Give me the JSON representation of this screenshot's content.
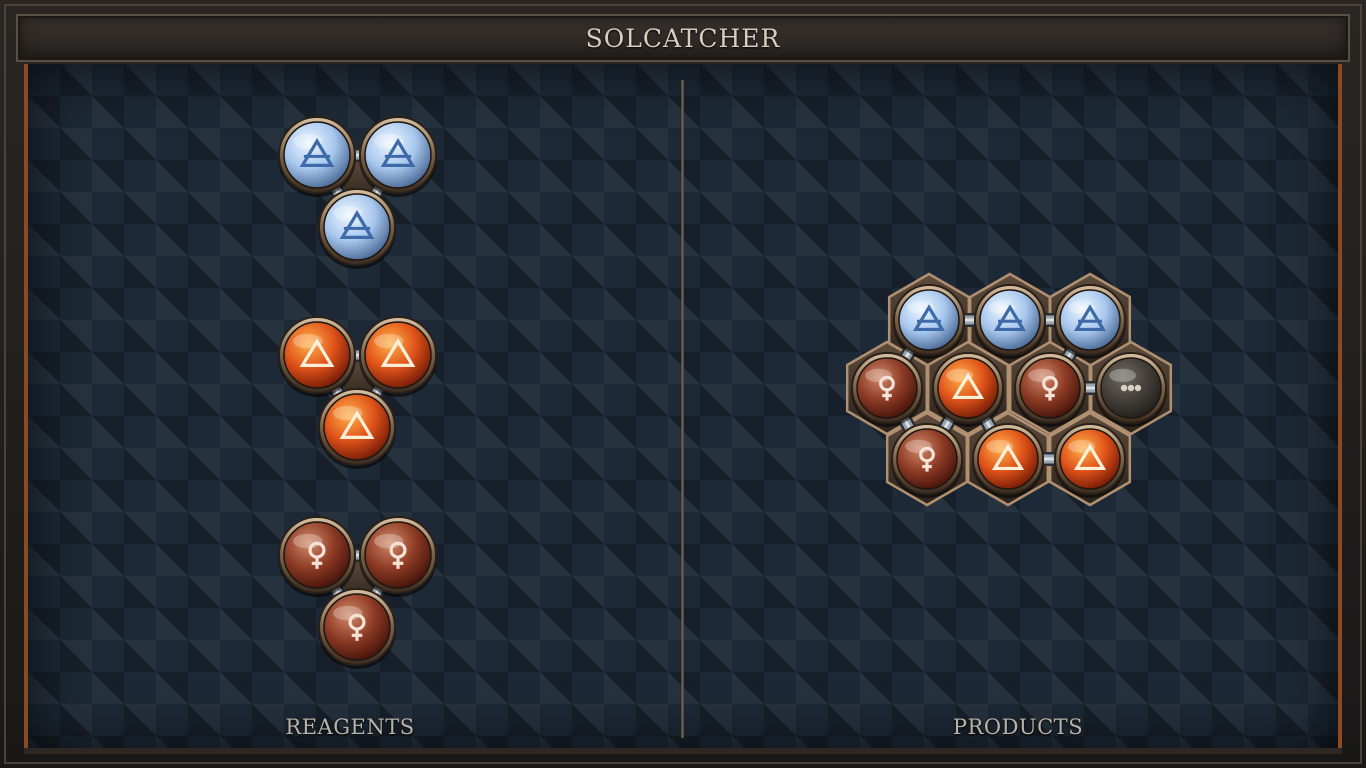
{
  "window": {
    "title": "SOLCATCHER"
  },
  "panels": {
    "reagents_label": "REAGENTS",
    "products_label": "PRODUCTS"
  },
  "element_types": {
    "air": {
      "name": "air",
      "symbol_icon": "air-triangle-icon",
      "colors": [
        "#eef6ff",
        "#a8c8ee",
        "#4f6e9a"
      ],
      "glyph_color": "#3e6aa8"
    },
    "fire": {
      "name": "fire",
      "symbol_icon": "fire-triangle-icon",
      "colors": [
        "#ffb24a",
        "#e0531a",
        "#7a1e08"
      ],
      "glyph_color": "#fff0d8"
    },
    "venus": {
      "name": "venus",
      "symbol_icon": "venus-icon",
      "colors": [
        "#d08a6a",
        "#8e3b25",
        "#4a160c"
      ],
      "glyph_color": "#f6e2d6"
    },
    "empty": {
      "name": "empty",
      "symbol_icon": "ellipsis-icon",
      "colors": [
        "#6e6a62",
        "#444039",
        "#24221e"
      ],
      "glyph_color": "#d6d2c8"
    }
  },
  "reagents": [
    {
      "name": "air-triad",
      "atoms": [
        "air",
        "air",
        "air"
      ]
    },
    {
      "name": "fire-triad",
      "atoms": [
        "fire",
        "fire",
        "fire"
      ]
    },
    {
      "name": "venus-triad",
      "atoms": [
        "venus",
        "venus",
        "venus"
      ]
    }
  ],
  "product": {
    "name": "solcatcher-product",
    "atoms": [
      "air",
      "air",
      "air",
      "venus",
      "fire",
      "venus",
      "empty",
      "venus",
      "fire",
      "fire"
    ]
  }
}
